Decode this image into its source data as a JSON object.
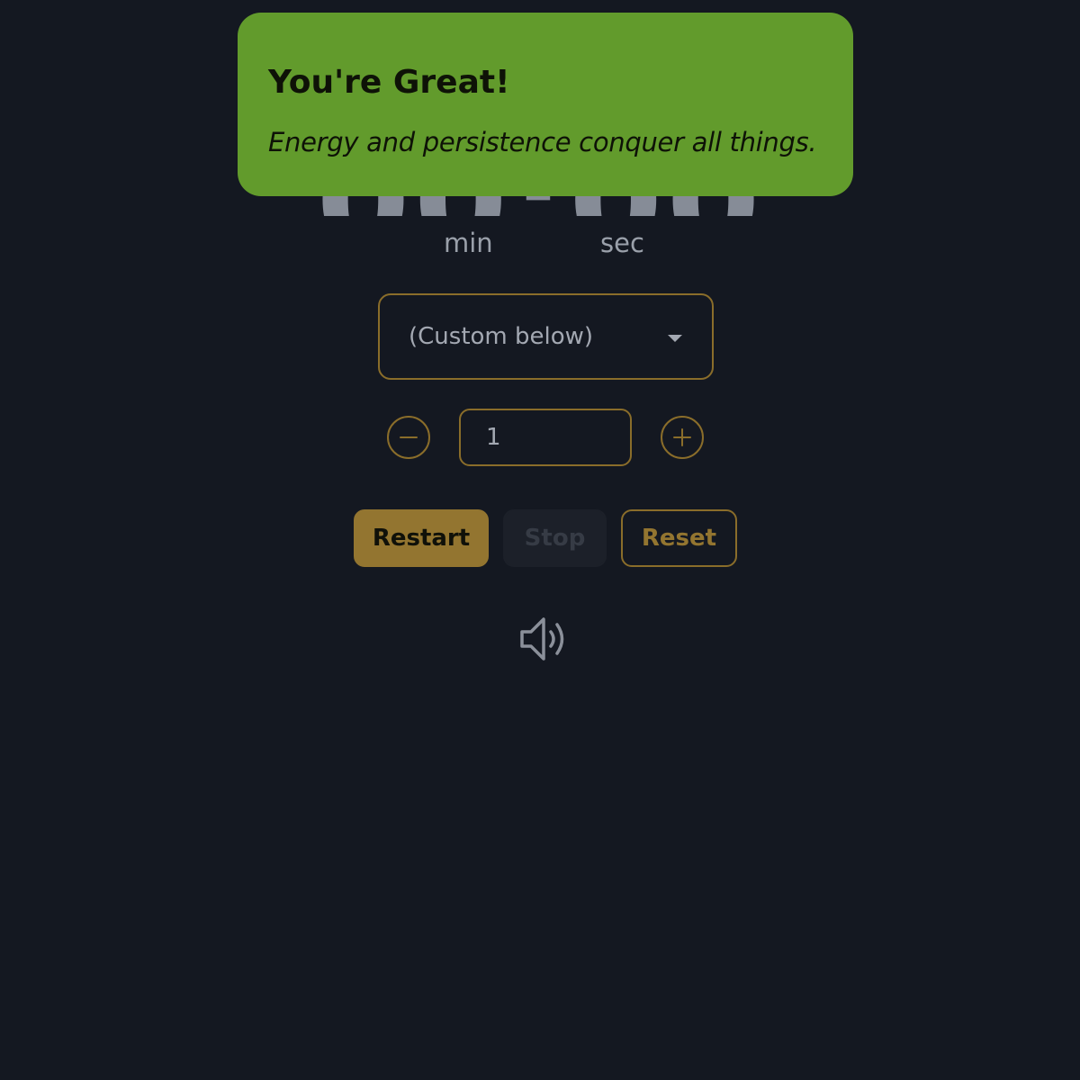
{
  "timer": {
    "digits": "00:00",
    "min_label": "min",
    "sec_label": "sec"
  },
  "toast": {
    "title": "You're Great!",
    "message": "Energy and persistence conquer all things.",
    "background_color": "#629b2c"
  },
  "preset": {
    "selected": "(Custom below)"
  },
  "stepper": {
    "value": "1",
    "decrement_icon": "minus-circle-icon",
    "increment_icon": "plus-circle-icon"
  },
  "actions": {
    "restart_label": "Restart",
    "stop_label": "Stop",
    "reset_label": "Reset"
  },
  "sound": {
    "icon": "speaker-volume-icon"
  },
  "colors": {
    "background": "#141821",
    "accent": "#937530",
    "toast": "#629b2c"
  }
}
